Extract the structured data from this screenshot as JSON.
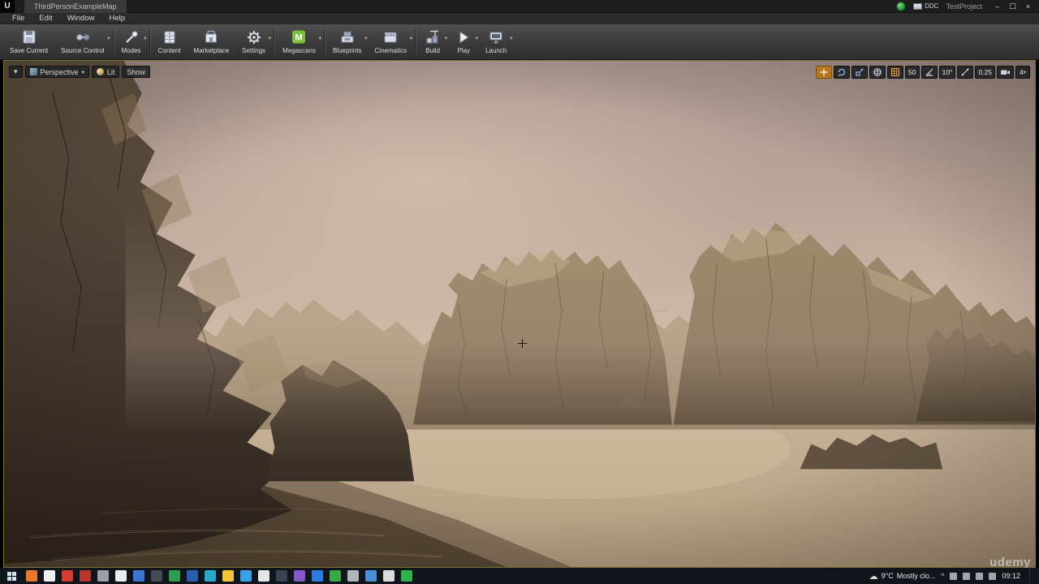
{
  "titlebar": {
    "logo_glyph": "U",
    "tab_title": "ThirdPersonExampleMap",
    "ddc_label": "DDC",
    "project_name": "TestProject",
    "window_controls": {
      "minimize": "–",
      "maximize": "□",
      "close": "×"
    }
  },
  "menubar": {
    "items": [
      "File",
      "Edit",
      "Window",
      "Help"
    ]
  },
  "toolbar": {
    "caret_glyph": "▾",
    "items": [
      {
        "label": "Save Current"
      },
      {
        "label": "Source Control"
      },
      {
        "label": "Modes"
      },
      {
        "label": "Content"
      },
      {
        "label": "Marketplace"
      },
      {
        "label": "Settings"
      },
      {
        "label": "Megascans",
        "glyph": "M"
      },
      {
        "label": "Blueprints"
      },
      {
        "label": "Cinematics"
      },
      {
        "label": "Build"
      },
      {
        "label": "Play"
      },
      {
        "label": "Launch"
      }
    ]
  },
  "viewport": {
    "dropdown_glyph": "▾",
    "perspective_label": "Perspective",
    "lit_label": "Lit",
    "show_label": "Show",
    "snap": {
      "grid": "50",
      "rotation": "10°",
      "scale": "0.25",
      "camera_speed": "4"
    }
  },
  "taskbar": {
    "apps": [
      {
        "color": "#e8762b"
      },
      {
        "color": "#f0f0f0"
      },
      {
        "color": "#d63c31"
      },
      {
        "color": "#b8352c"
      },
      {
        "color": "#9aa0a6"
      },
      {
        "color": "#ececec"
      },
      {
        "color": "#3a76d0"
      },
      {
        "color": "#454b54"
      },
      {
        "color": "#2e9e4f"
      },
      {
        "color": "#2a5fb0"
      },
      {
        "color": "#28a8c8"
      },
      {
        "color": "#f3c53a"
      },
      {
        "color": "#3aa0e8"
      },
      {
        "color": "#e6e6e6"
      },
      {
        "color": "#394250"
      },
      {
        "color": "#8458c8"
      },
      {
        "color": "#2b7de0"
      },
      {
        "color": "#38a84a"
      },
      {
        "color": "#b0b5ba"
      },
      {
        "color": "#4a90d9"
      },
      {
        "color": "#dcdcdc"
      },
      {
        "color": "#2bb24c"
      }
    ],
    "tray": {
      "weather_temp": "9°C",
      "weather_condition": "Mostly clo...",
      "caret": "^",
      "time": "09:12"
    }
  },
  "watermark": "udemy"
}
